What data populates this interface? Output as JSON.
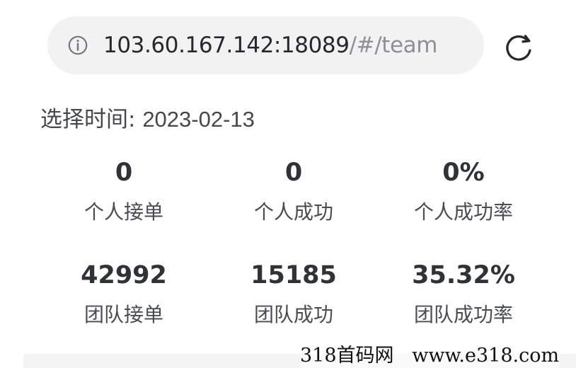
{
  "browser": {
    "address_host": "103.60.167.142:18089",
    "address_path": "/#/team",
    "info_icon": "info-icon",
    "reload_icon": "reload-icon"
  },
  "filter": {
    "date_label": "选择时间: ",
    "date_value": "2023-02-13"
  },
  "stats": {
    "personal": [
      {
        "value": "0",
        "label": "个人接单"
      },
      {
        "value": "0",
        "label": "个人成功"
      },
      {
        "value": "0%",
        "label": "个人成功率"
      }
    ],
    "team": [
      {
        "value": "42992",
        "label": "团队接单"
      },
      {
        "value": "15185",
        "label": "团队成功"
      },
      {
        "value": "35.32%",
        "label": "团队成功率"
      }
    ]
  },
  "watermark": {
    "text": "318首码网   www.e318.com"
  },
  "colors": {
    "url_background": "#f2f2f2",
    "primary_text": "#2f3237",
    "secondary_text": "#8d9095"
  }
}
